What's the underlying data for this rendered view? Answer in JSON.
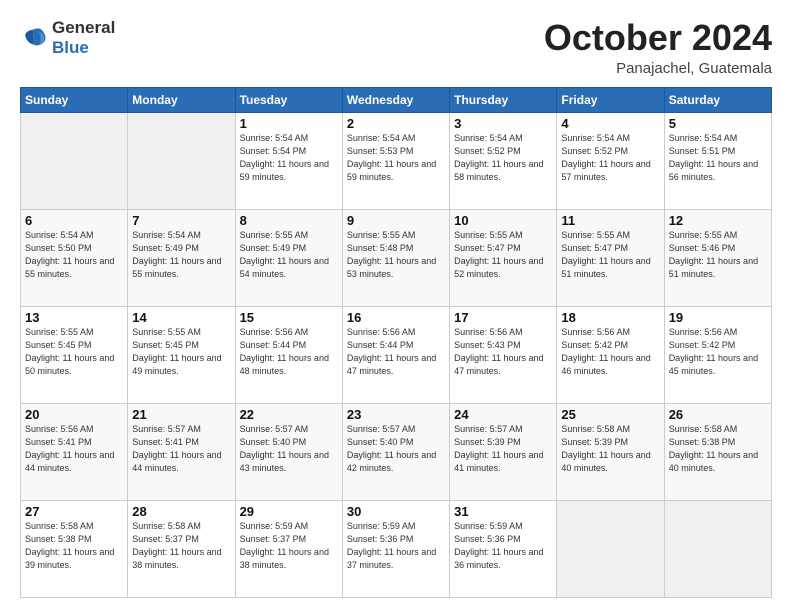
{
  "logo": {
    "line1": "General",
    "line2": "Blue"
  },
  "header": {
    "title": "October 2024",
    "subtitle": "Panajachel, Guatemala"
  },
  "weekdays": [
    "Sunday",
    "Monday",
    "Tuesday",
    "Wednesday",
    "Thursday",
    "Friday",
    "Saturday"
  ],
  "weeks": [
    [
      {
        "day": "",
        "info": ""
      },
      {
        "day": "",
        "info": ""
      },
      {
        "day": "1",
        "info": "Sunrise: 5:54 AM\nSunset: 5:54 PM\nDaylight: 11 hours\nand 59 minutes."
      },
      {
        "day": "2",
        "info": "Sunrise: 5:54 AM\nSunset: 5:53 PM\nDaylight: 11 hours\nand 59 minutes."
      },
      {
        "day": "3",
        "info": "Sunrise: 5:54 AM\nSunset: 5:52 PM\nDaylight: 11 hours\nand 58 minutes."
      },
      {
        "day": "4",
        "info": "Sunrise: 5:54 AM\nSunset: 5:52 PM\nDaylight: 11 hours\nand 57 minutes."
      },
      {
        "day": "5",
        "info": "Sunrise: 5:54 AM\nSunset: 5:51 PM\nDaylight: 11 hours\nand 56 minutes."
      }
    ],
    [
      {
        "day": "6",
        "info": "Sunrise: 5:54 AM\nSunset: 5:50 PM\nDaylight: 11 hours\nand 55 minutes."
      },
      {
        "day": "7",
        "info": "Sunrise: 5:54 AM\nSunset: 5:49 PM\nDaylight: 11 hours\nand 55 minutes."
      },
      {
        "day": "8",
        "info": "Sunrise: 5:55 AM\nSunset: 5:49 PM\nDaylight: 11 hours\nand 54 minutes."
      },
      {
        "day": "9",
        "info": "Sunrise: 5:55 AM\nSunset: 5:48 PM\nDaylight: 11 hours\nand 53 minutes."
      },
      {
        "day": "10",
        "info": "Sunrise: 5:55 AM\nSunset: 5:47 PM\nDaylight: 11 hours\nand 52 minutes."
      },
      {
        "day": "11",
        "info": "Sunrise: 5:55 AM\nSunset: 5:47 PM\nDaylight: 11 hours\nand 51 minutes."
      },
      {
        "day": "12",
        "info": "Sunrise: 5:55 AM\nSunset: 5:46 PM\nDaylight: 11 hours\nand 51 minutes."
      }
    ],
    [
      {
        "day": "13",
        "info": "Sunrise: 5:55 AM\nSunset: 5:45 PM\nDaylight: 11 hours\nand 50 minutes."
      },
      {
        "day": "14",
        "info": "Sunrise: 5:55 AM\nSunset: 5:45 PM\nDaylight: 11 hours\nand 49 minutes."
      },
      {
        "day": "15",
        "info": "Sunrise: 5:56 AM\nSunset: 5:44 PM\nDaylight: 11 hours\nand 48 minutes."
      },
      {
        "day": "16",
        "info": "Sunrise: 5:56 AM\nSunset: 5:44 PM\nDaylight: 11 hours\nand 47 minutes."
      },
      {
        "day": "17",
        "info": "Sunrise: 5:56 AM\nSunset: 5:43 PM\nDaylight: 11 hours\nand 47 minutes."
      },
      {
        "day": "18",
        "info": "Sunrise: 5:56 AM\nSunset: 5:42 PM\nDaylight: 11 hours\nand 46 minutes."
      },
      {
        "day": "19",
        "info": "Sunrise: 5:56 AM\nSunset: 5:42 PM\nDaylight: 11 hours\nand 45 minutes."
      }
    ],
    [
      {
        "day": "20",
        "info": "Sunrise: 5:56 AM\nSunset: 5:41 PM\nDaylight: 11 hours\nand 44 minutes."
      },
      {
        "day": "21",
        "info": "Sunrise: 5:57 AM\nSunset: 5:41 PM\nDaylight: 11 hours\nand 44 minutes."
      },
      {
        "day": "22",
        "info": "Sunrise: 5:57 AM\nSunset: 5:40 PM\nDaylight: 11 hours\nand 43 minutes."
      },
      {
        "day": "23",
        "info": "Sunrise: 5:57 AM\nSunset: 5:40 PM\nDaylight: 11 hours\nand 42 minutes."
      },
      {
        "day": "24",
        "info": "Sunrise: 5:57 AM\nSunset: 5:39 PM\nDaylight: 11 hours\nand 41 minutes."
      },
      {
        "day": "25",
        "info": "Sunrise: 5:58 AM\nSunset: 5:39 PM\nDaylight: 11 hours\nand 40 minutes."
      },
      {
        "day": "26",
        "info": "Sunrise: 5:58 AM\nSunset: 5:38 PM\nDaylight: 11 hours\nand 40 minutes."
      }
    ],
    [
      {
        "day": "27",
        "info": "Sunrise: 5:58 AM\nSunset: 5:38 PM\nDaylight: 11 hours\nand 39 minutes."
      },
      {
        "day": "28",
        "info": "Sunrise: 5:58 AM\nSunset: 5:37 PM\nDaylight: 11 hours\nand 38 minutes."
      },
      {
        "day": "29",
        "info": "Sunrise: 5:59 AM\nSunset: 5:37 PM\nDaylight: 11 hours\nand 38 minutes."
      },
      {
        "day": "30",
        "info": "Sunrise: 5:59 AM\nSunset: 5:36 PM\nDaylight: 11 hours\nand 37 minutes."
      },
      {
        "day": "31",
        "info": "Sunrise: 5:59 AM\nSunset: 5:36 PM\nDaylight: 11 hours\nand 36 minutes."
      },
      {
        "day": "",
        "info": ""
      },
      {
        "day": "",
        "info": ""
      }
    ]
  ]
}
